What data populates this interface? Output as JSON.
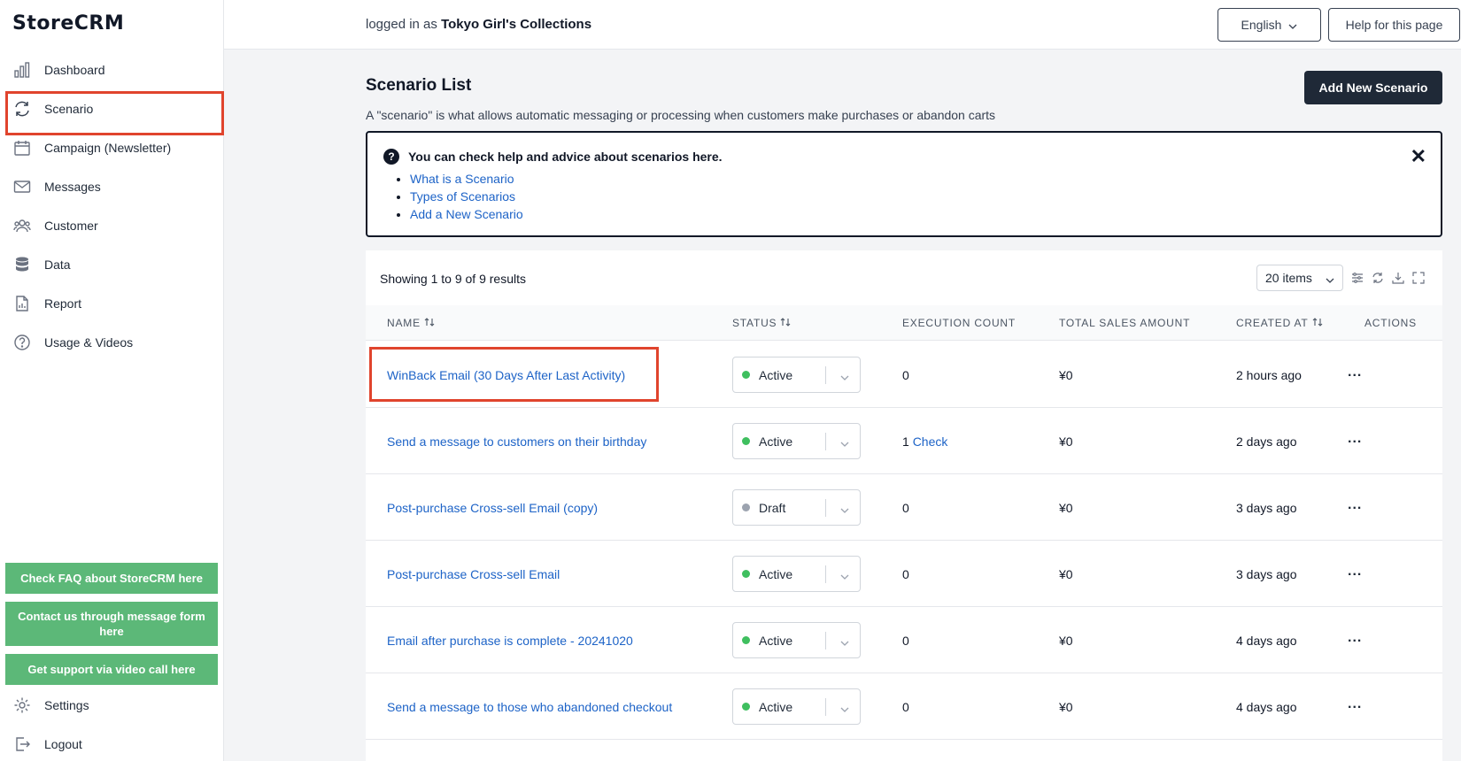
{
  "app": {
    "logo": "StoreCRM"
  },
  "sidebar": {
    "items": [
      {
        "label": "Dashboard",
        "icon": "chart-bars-icon"
      },
      {
        "label": "Scenario",
        "icon": "refresh-icon",
        "active": true
      },
      {
        "label": "Campaign (Newsletter)",
        "icon": "calendar-icon"
      },
      {
        "label": "Messages",
        "icon": "envelope-icon"
      },
      {
        "label": "Customer",
        "icon": "users-icon"
      },
      {
        "label": "Data",
        "icon": "database-icon"
      },
      {
        "label": "Report",
        "icon": "document-chart-icon"
      },
      {
        "label": "Usage & Videos",
        "icon": "question-circle-icon"
      }
    ],
    "support_buttons": [
      "Check FAQ about StoreCRM here",
      "Contact us through message form here",
      "Get support via video call here"
    ],
    "settings_label": "Settings",
    "logout_label": "Logout",
    "accent_color": "#5cb878"
  },
  "topbar": {
    "logged_prefix": "logged in as",
    "store_name": "Tokyo Girl's Collections",
    "language": "English",
    "help_button": "Help for this page"
  },
  "main": {
    "title": "Scenario List",
    "description": "A \"scenario\" is what allows automatic messaging or processing when customers make purchases or abandon carts",
    "add_button": "Add New Scenario",
    "help_box": {
      "title": "You can check help and advice about scenarios here.",
      "links": [
        "What is a Scenario",
        "Types of Scenarios",
        "Add a New Scenario"
      ]
    },
    "table": {
      "showing": "Showing 1 to 9 of 9 results",
      "page_size": "20 items",
      "columns": [
        "NAME",
        "STATUS",
        "EXECUTION COUNT",
        "TOTAL SALES AMOUNT",
        "CREATED AT",
        "ACTIONS"
      ],
      "rows": [
        {
          "name": "WinBack Email (30 Days After Last Activity)",
          "status": "Active",
          "count": "0",
          "check": "",
          "sales": "¥0",
          "created": "2 hours ago"
        },
        {
          "name": "Send a message to customers on their birthday",
          "status": "Active",
          "count": "1",
          "check": "Check",
          "sales": "¥0",
          "created": "2 days ago"
        },
        {
          "name": "Post-purchase Cross-sell Email (copy)",
          "status": "Draft",
          "count": "0",
          "check": "",
          "sales": "¥0",
          "created": "3 days ago"
        },
        {
          "name": "Post-purchase Cross-sell Email",
          "status": "Active",
          "count": "0",
          "check": "",
          "sales": "¥0",
          "created": "3 days ago"
        },
        {
          "name": "Email after purchase is complete - 20241020",
          "status": "Active",
          "count": "0",
          "check": "",
          "sales": "¥0",
          "created": "4 days ago"
        },
        {
          "name": "Send a message to those who abandoned checkout",
          "status": "Active",
          "count": "0",
          "check": "",
          "sales": "¥0",
          "created": "4 days ago"
        }
      ],
      "actions_label": "...",
      "status_colors": {
        "Active": "#3fbf5f",
        "Draft": "#9ca3af"
      }
    }
  }
}
